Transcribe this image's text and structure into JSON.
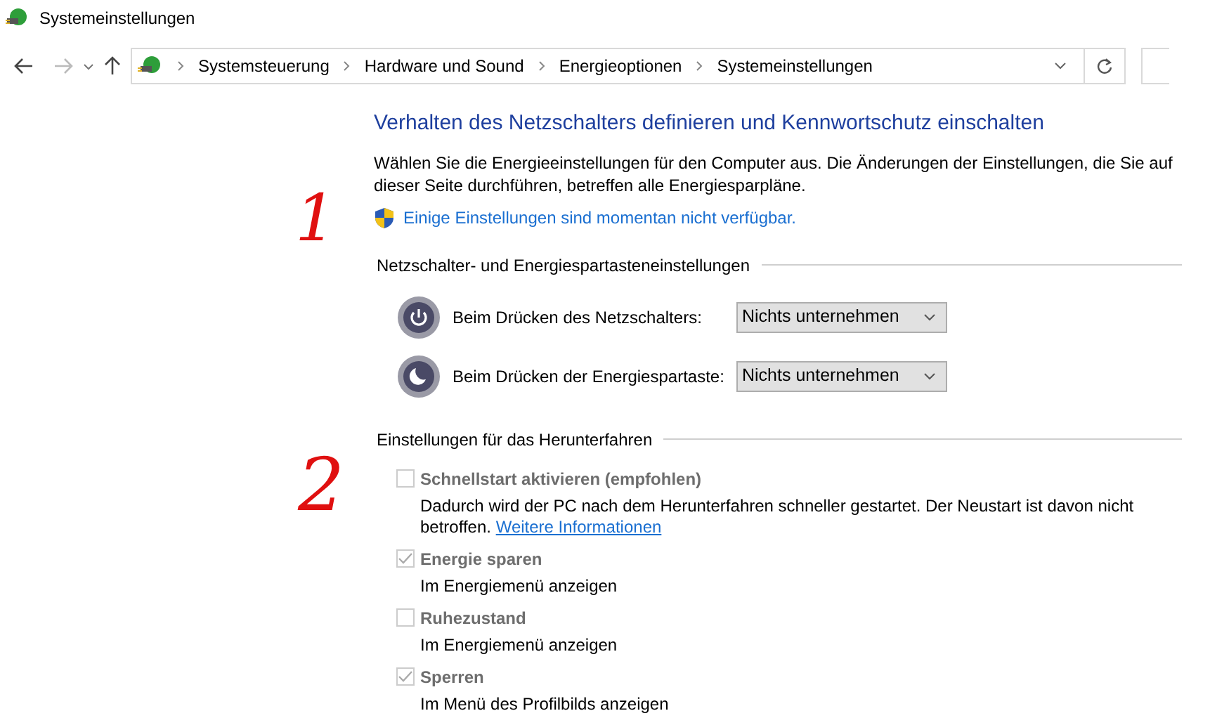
{
  "window": {
    "title": "Systemeinstellungen"
  },
  "nav": {
    "back_disabled": false,
    "forward_disabled": true,
    "breadcrumb": [
      "Systemsteuerung",
      "Hardware und Sound",
      "Energieoptionen",
      "Systemeinstellungen"
    ]
  },
  "heading": "Verhalten des Netzschalters definieren und Kennwortschutz einschalten",
  "intro": "Wählen Sie die Energieeinstellungen für den Computer aus. Die Änderungen der Einstellungen, die Sie auf dieser Seite durchführen, betreffen alle Energiesparpläne.",
  "admin_link": "Einige Einstellungen sind momentan nicht verfügbar.",
  "button_section": {
    "title": "Netzschalter- und Energiespartasteneinstellungen",
    "rows": [
      {
        "kind": "power",
        "label": "Beim Drücken des Netzschalters:",
        "value": "Nichts unternehmen"
      },
      {
        "kind": "sleep",
        "label": "Beim Drücken der Energiespartaste:",
        "value": "Nichts unternehmen"
      }
    ]
  },
  "shutdown_section": {
    "title": "Einstellungen für das Herunterfahren",
    "options": [
      {
        "label": "Schnellstart aktivieren (empfohlen)",
        "checked": false,
        "disabled": true,
        "description": "Dadurch wird der PC nach dem Herunterfahren schneller gestartet. Der Neustart ist davon nicht betroffen.",
        "link": "Weitere Informationen"
      },
      {
        "label": "Energie sparen",
        "checked": true,
        "disabled": true,
        "description": "Im Energiemenü anzeigen"
      },
      {
        "label": "Ruhezustand",
        "checked": false,
        "disabled": true,
        "description": "Im Energiemenü anzeigen"
      },
      {
        "label": "Sperren",
        "checked": true,
        "disabled": true,
        "description": "Im Menü des Profilbilds anzeigen"
      }
    ]
  },
  "annotations": [
    "1",
    "2"
  ]
}
